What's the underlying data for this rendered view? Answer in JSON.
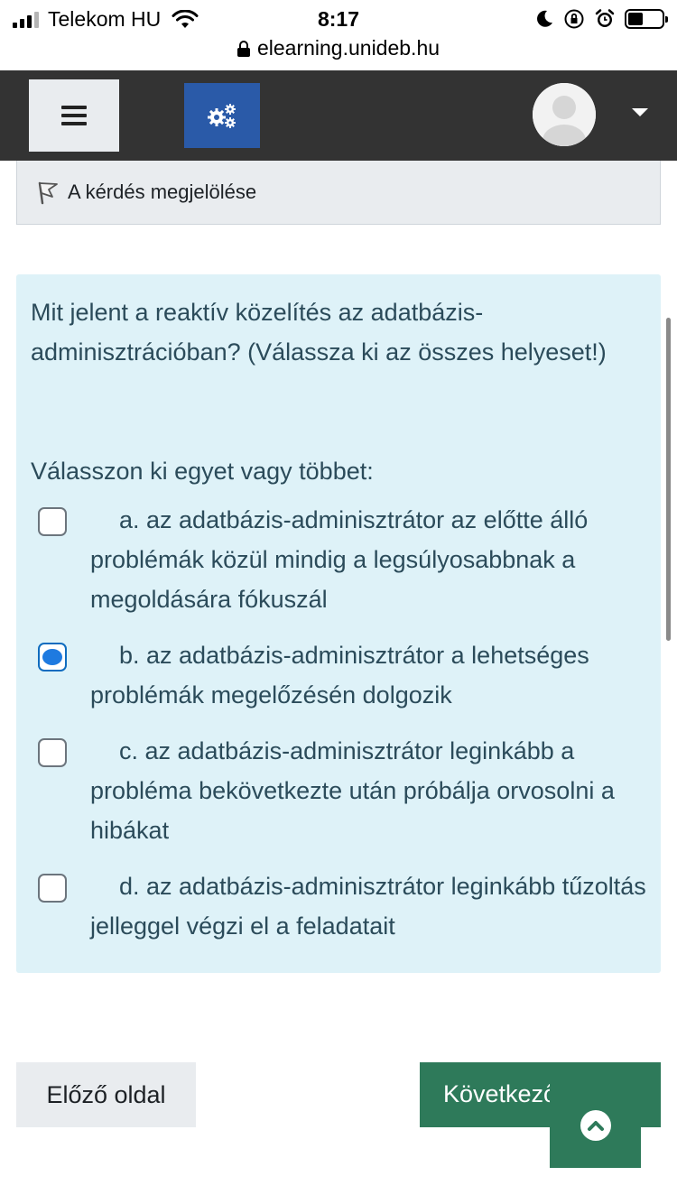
{
  "status_bar": {
    "carrier": "Telekom HU",
    "time": "8:17",
    "url": "elearning.unideb.hu"
  },
  "navbar": {
    "menu_icon": "hamburger-icon",
    "settings_icon": "gears-icon",
    "avatar_icon": "user-avatar-icon",
    "caret_icon": "caret-down-icon"
  },
  "flag": {
    "label": "A kérdés megjelölése",
    "icon": "flag-icon"
  },
  "question": {
    "text": "Mit jelent a reaktív közelítés az adatbázis-adminisztrációban? (Válassza ki az összes helyeset!)",
    "prompt": "Válasszon ki egyet vagy többet:",
    "answers": [
      {
        "text": "a. az adatbázis-adminisztrátor az előtte álló problémák közül mindig a legsúlyosabbnak a megoldására fókuszál",
        "checked": false
      },
      {
        "text": "b. az adatbázis-adminisztrátor a lehetséges problémák megelőzésén dolgozik",
        "checked": true
      },
      {
        "text": "c. az adatbázis-adminisztrátor leginkább a probléma bekövetkezte után próbálja orvosolni a hibákat",
        "checked": false
      },
      {
        "text": "d. az adatbázis-adminisztrátor leginkább tűzoltás jelleggel végzi el a feladatait",
        "checked": false
      }
    ]
  },
  "navigation": {
    "prev_label": "Előző oldal",
    "next_label": "Következő oldal",
    "back_to_top_icon": "arrow-up-circle-icon"
  },
  "colors": {
    "navbar": "#333333",
    "settings_button": "#2a5aa8",
    "question_background": "#def2f8",
    "question_text": "#2b4b5a",
    "next_button": "#2e7a5a",
    "checkbox_checked": "#1e7ae0"
  }
}
